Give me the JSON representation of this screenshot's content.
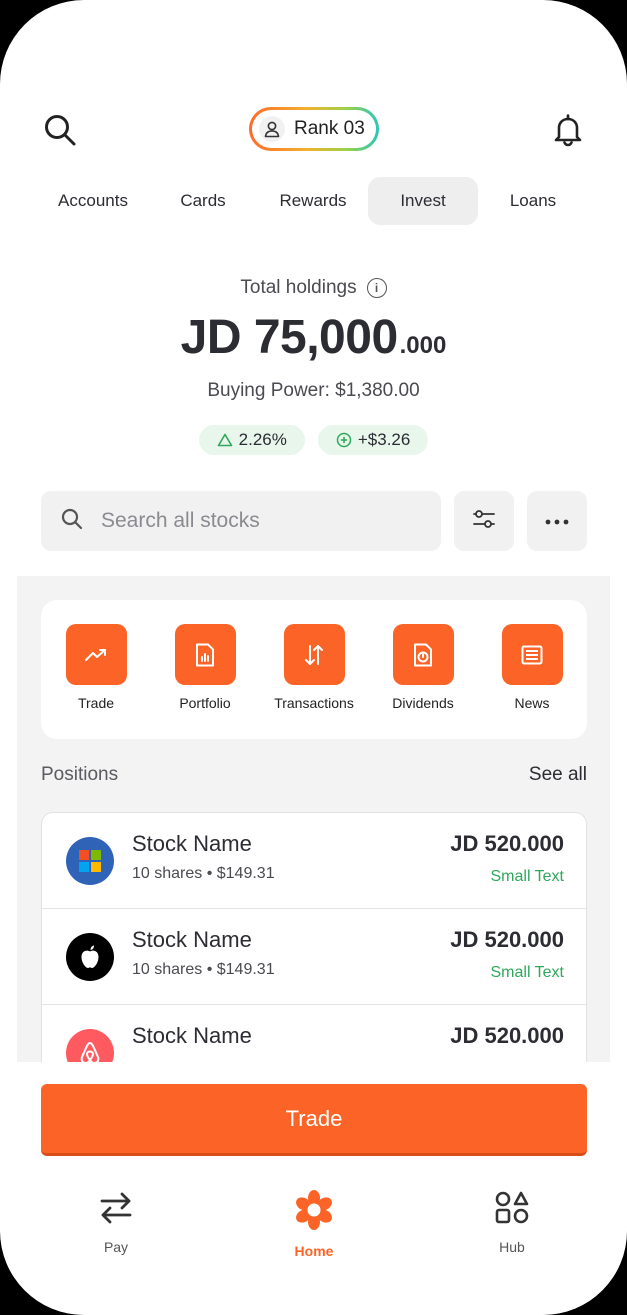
{
  "header": {
    "rank_label": "Rank 03"
  },
  "tabs": [
    {
      "label": "Accounts"
    },
    {
      "label": "Cards"
    },
    {
      "label": "Rewards"
    },
    {
      "label": "Invest",
      "active": true
    },
    {
      "label": "Loans"
    }
  ],
  "holdings": {
    "label": "Total holdings",
    "info_glyph": "i",
    "currency_amount": "JD 75,000",
    "decimal": ".000",
    "buying_power": "Buying Power: $1,380.00",
    "change_percent": "2.26%",
    "change_amount": "+$3.26"
  },
  "search": {
    "placeholder": "Search all stocks"
  },
  "quick_actions": [
    {
      "label": "Trade",
      "icon": "trending-up-icon"
    },
    {
      "label": "Portfolio",
      "icon": "report-chart-icon"
    },
    {
      "label": "Transactions",
      "icon": "arrows-up-down-icon"
    },
    {
      "label": "Dividends",
      "icon": "dividend-document-icon"
    },
    {
      "label": "News",
      "icon": "newspaper-icon"
    }
  ],
  "positions": {
    "title": "Positions",
    "see_all": "See all",
    "items": [
      {
        "name": "Stock Name",
        "sub": "10 shares • $149.31",
        "value": "JD 520.000",
        "small": "Small Text",
        "logo": "microsoft-logo"
      },
      {
        "name": "Stock Name",
        "sub": "10 shares • $149.31",
        "value": "JD 520.000",
        "small": "Small Text",
        "logo": "apple-logo"
      },
      {
        "name": "Stock Name",
        "value": "JD 520.000",
        "logo": "airbnb-logo"
      }
    ]
  },
  "trade_button": "Trade",
  "bottom_nav": [
    {
      "label": "Pay",
      "icon": "transfer-arrows-icon"
    },
    {
      "label": "Home",
      "icon": "flower-logo-icon",
      "active": true
    },
    {
      "label": "Hub",
      "icon": "shapes-icon"
    }
  ],
  "colors": {
    "accent": "#fc6427",
    "positive": "#2fa85b",
    "positive_bg": "#e8f6ec"
  }
}
